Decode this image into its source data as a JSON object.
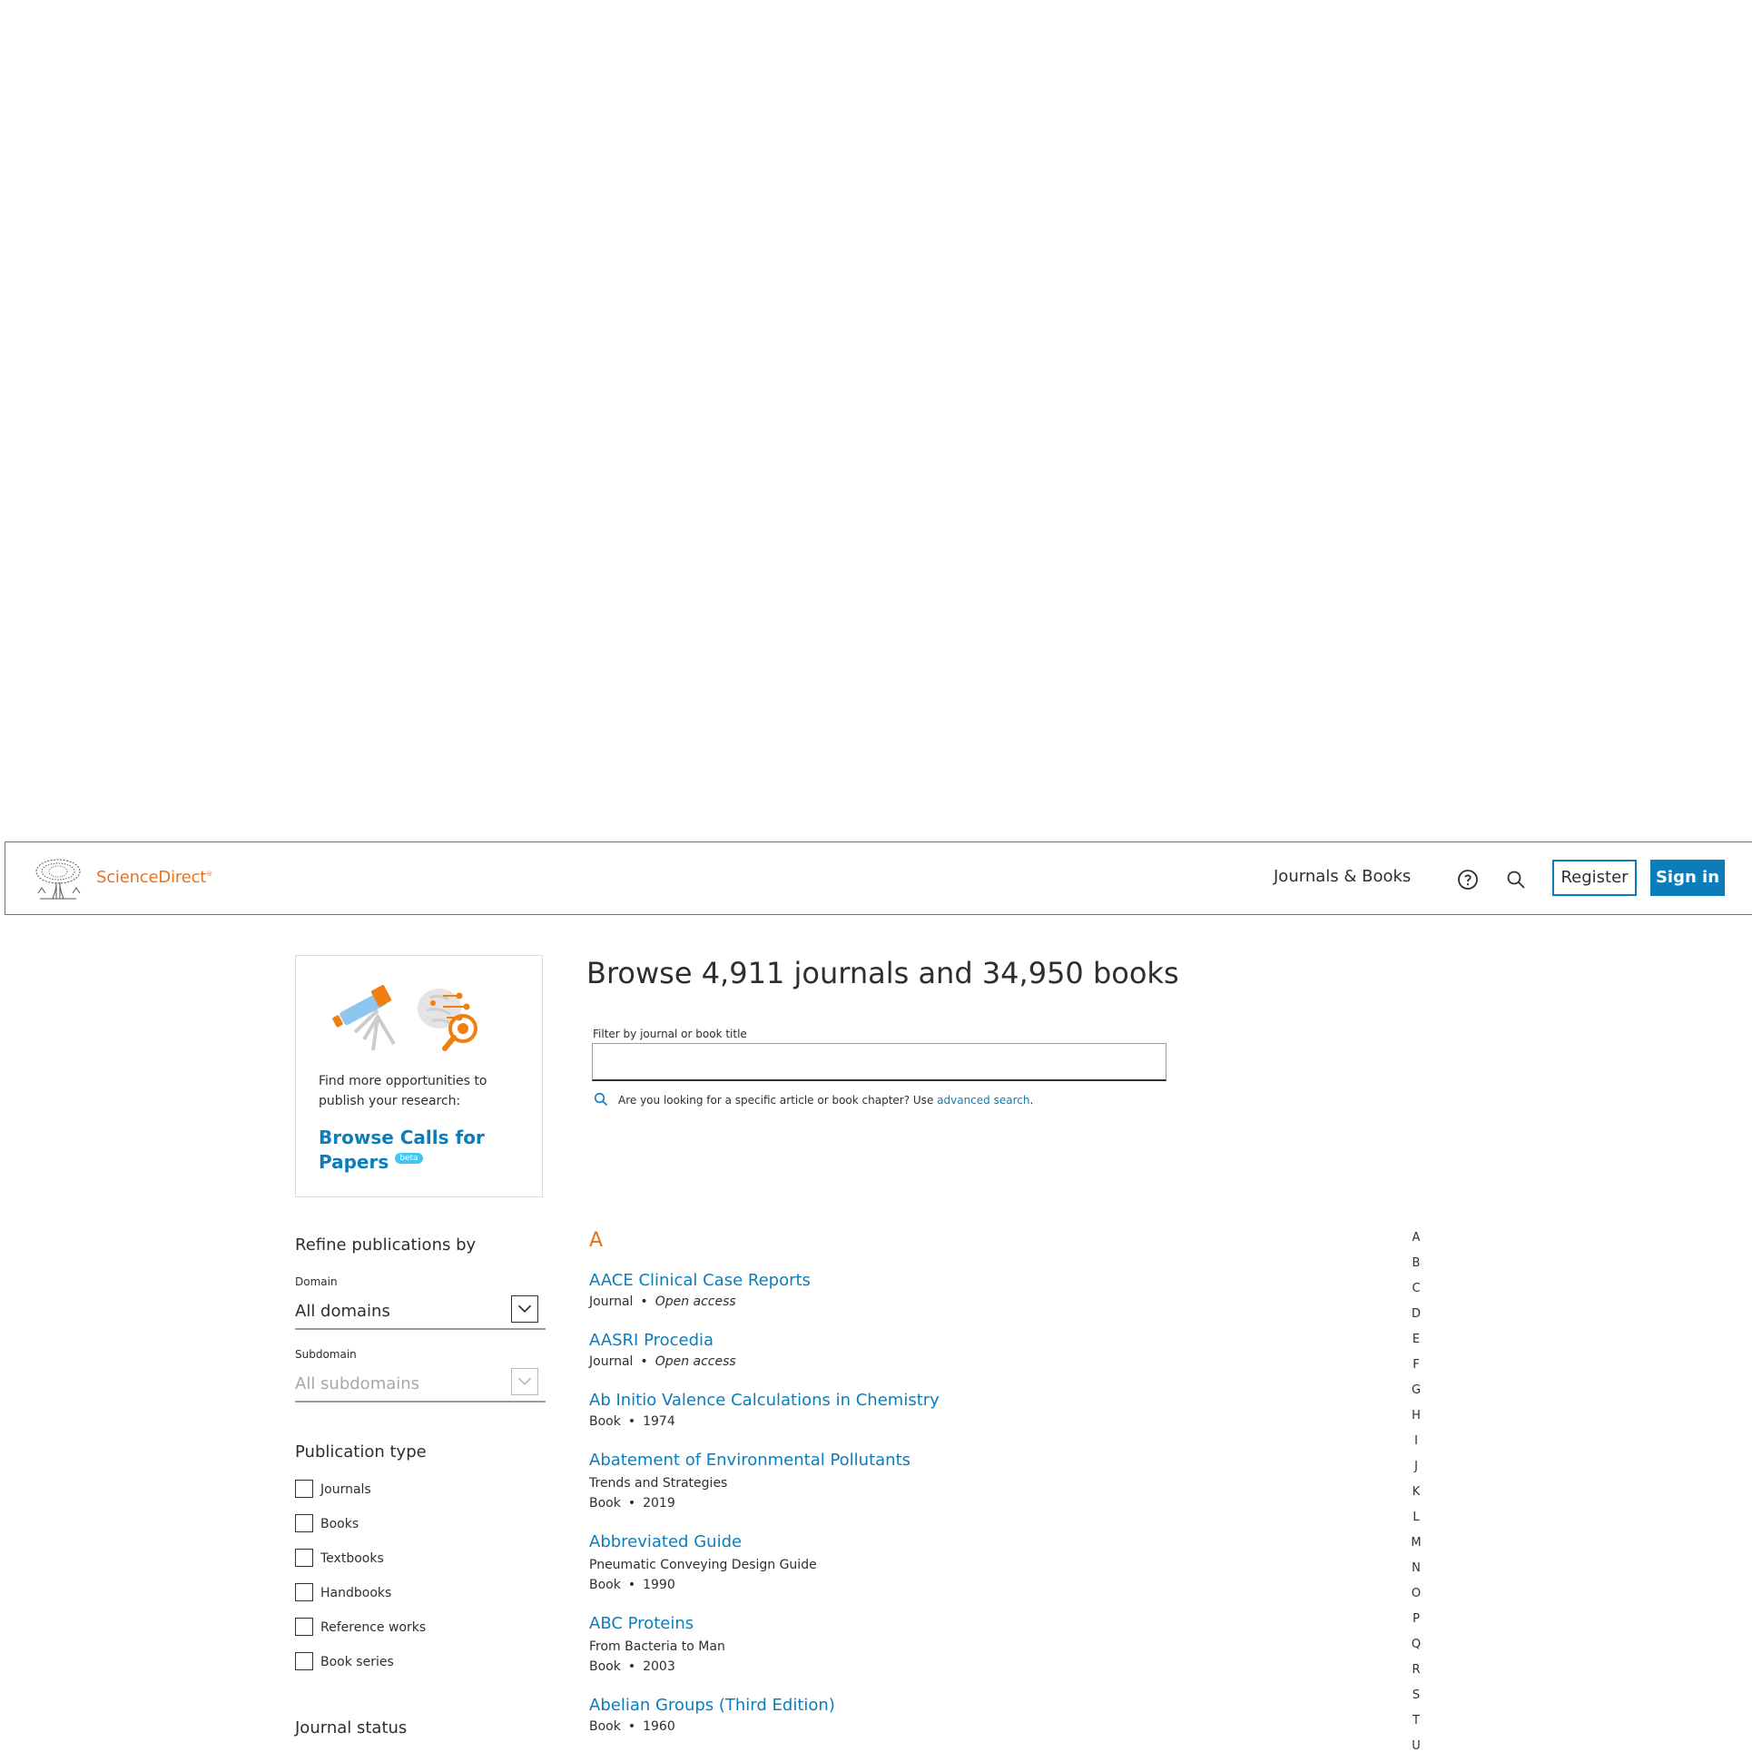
{
  "header": {
    "brand": "ScienceDirect",
    "nav_journals": "Journals & Books",
    "register": "Register",
    "sign_in": "Sign in"
  },
  "promo": {
    "text": "Find more opportunities to publish your research:",
    "link": "Browse Calls for Papers",
    "badge": "beta"
  },
  "main": {
    "title": "Browse 4,911 journals and 34,950 books",
    "filter_label": "Filter by journal or book title",
    "filter_value": "",
    "hint_text": "Are you looking for a specific article or book chapter? Use ",
    "hint_link": "advanced search",
    "hint_end": "."
  },
  "refine": {
    "title": "Refine publications by",
    "domain_label": "Domain",
    "domain_value": "All domains",
    "subdomain_label": "Subdomain",
    "subdomain_value": "All subdomains",
    "pubtype_title": "Publication type",
    "pubtypes": [
      "Journals",
      "Books",
      "Textbooks",
      "Handbooks",
      "Reference works",
      "Book series"
    ],
    "journal_status_title": "Journal status"
  },
  "list": {
    "letter": "A",
    "items": [
      {
        "title": "AACE Clinical Case Reports",
        "subtitle": "",
        "type": "Journal",
        "detail": "Open access"
      },
      {
        "title": "AASRI Procedia",
        "subtitle": "",
        "type": "Journal",
        "detail": "Open access"
      },
      {
        "title": "Ab Initio Valence Calculations in Chemistry",
        "subtitle": "",
        "type": "Book",
        "detail": "1974"
      },
      {
        "title": "Abatement of Environmental Pollutants",
        "subtitle": "Trends and Strategies",
        "type": "Book",
        "detail": "2019"
      },
      {
        "title": "Abbreviated Guide",
        "subtitle": "Pneumatic Conveying Design Guide",
        "type": "Book",
        "detail": "1990"
      },
      {
        "title": "ABC Proteins",
        "subtitle": "From Bacteria to Man",
        "type": "Book",
        "detail": "2003"
      },
      {
        "title": "Abelian Groups (Third Edition)",
        "subtitle": "",
        "type": "Book",
        "detail": "1960"
      }
    ]
  },
  "alphabet": [
    "A",
    "B",
    "C",
    "D",
    "E",
    "F",
    "G",
    "H",
    "I",
    "J",
    "K",
    "L",
    "M",
    "N",
    "O",
    "P",
    "Q",
    "R",
    "S",
    "T",
    "U"
  ],
  "colors": {
    "link": "#0c7dbb",
    "brand": "#e9711c",
    "header_border": "#e9414a"
  },
  "icons": [
    "elsevier-tree-logo",
    "help-icon",
    "search-icon",
    "telescope-illustration",
    "brain-search-illustration",
    "chevron-down-icon"
  ]
}
